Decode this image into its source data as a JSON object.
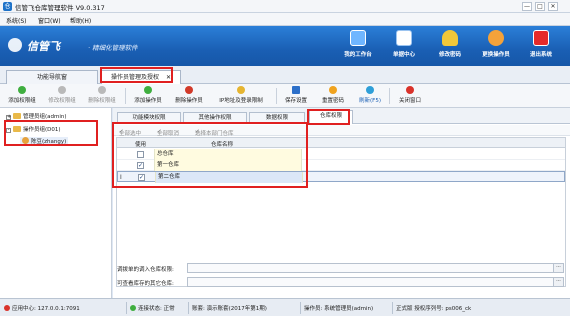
{
  "window": {
    "title": "信管飞仓库管理软件 V9.0.317",
    "min": "—",
    "max": "□",
    "close": "✕"
  },
  "menu": [
    "系统(S)",
    "窗口(W)",
    "帮助(H)"
  ],
  "brand": {
    "name": "信管飞",
    "slogan": "· 精细化管理软件"
  },
  "top_buttons": [
    {
      "label": "我的工作台",
      "icon": "monitor-icon",
      "color": "#6fb6ff"
    },
    {
      "label": "单据中心",
      "icon": "document-list-icon",
      "color": "#ffffff"
    },
    {
      "label": "修改密码",
      "icon": "lock-icon",
      "color": "#f2c83a"
    },
    {
      "label": "更换操作员",
      "icon": "user-switch-icon",
      "color": "#f4a23a"
    },
    {
      "label": "退出系统",
      "icon": "power-icon",
      "color": "#e52a2a"
    }
  ],
  "main_tabs": {
    "nav": "功能导航窗",
    "active": "操作员管理及授权",
    "close": "✕"
  },
  "toolbar": {
    "add_group": "添加权限组",
    "edit_group": "修改权限组",
    "delete_group": "删除权限组",
    "add_operator": "添加操作员",
    "delete_operator": "删除操作员",
    "login_limit": "IP地址及登录限制",
    "save": "保存设置",
    "reset_password": "重置密码",
    "refresh": "刷新(F5)",
    "close_window": "关闭窗口"
  },
  "tree": {
    "admin_group": "管理员组(admin)",
    "operator_group": "操作员组(D01)",
    "user": "陈豆(zhangy)"
  },
  "sub_tabs": [
    "功能模块权限",
    "其他操作权限",
    "数据权限",
    "仓库权限"
  ],
  "sub_toolbar": {
    "select_all": "全部选中",
    "deselect_all": "全部取消",
    "select_dept": "选择本部门仓库"
  },
  "grid": {
    "headers": {
      "use": "使用",
      "warehouse_name": "仓库名称"
    },
    "rows": [
      {
        "name": "总仓库",
        "checked": ""
      },
      {
        "name": "第一仓库",
        "checked": "✓"
      },
      {
        "name": "第二仓库",
        "checked": "✓",
        "indicator": "I"
      }
    ]
  },
  "form": {
    "transfer_label": "调拨单的调入仓库权限:",
    "query_label": "可查看库存的其它仓库:",
    "ellipsis": "···"
  },
  "status": {
    "app_center": "应用中心: 127.0.0.1:7091",
    "connection": "连接状态: 正常",
    "account": "账套: 演示账套(2017年第1期)",
    "operator": "操作员: 系统管理员(admin)",
    "version": "正式版 授权序列号: ps006_ck"
  },
  "colors": {
    "banner": "#1a5fb4",
    "highlight": "#e02020",
    "accent": "#1a5fb4"
  }
}
